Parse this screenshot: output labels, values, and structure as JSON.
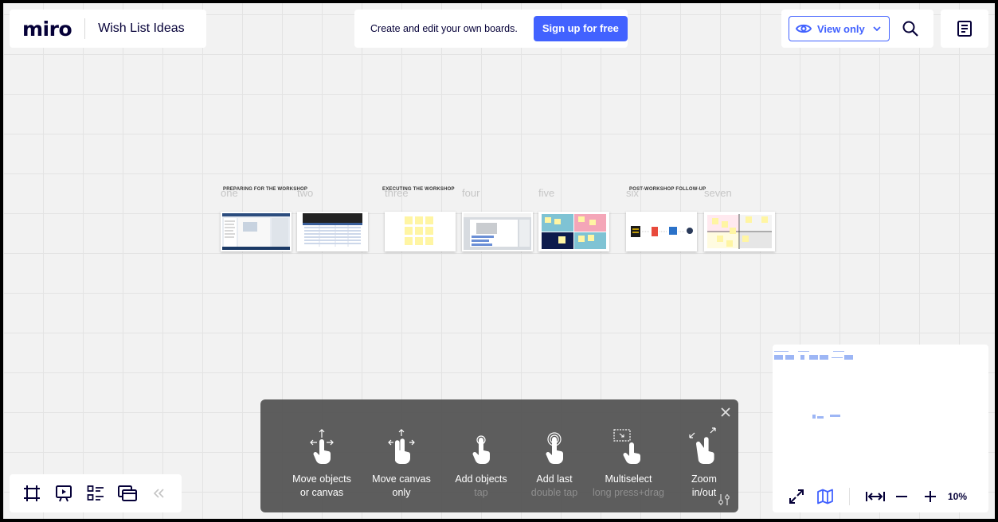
{
  "header": {
    "logo": "miro",
    "board_title": "Wish List Ideas",
    "signup_text": "Create and edit your own boards.",
    "signup_button": "Sign up for free",
    "view_only": "View only"
  },
  "board": {
    "sections": [
      {
        "title": "PREPARING FOR THE WORKSHOP"
      },
      {
        "title": "EXECUTING THE WORKSHOP"
      },
      {
        "title": "POST-WORKSHOP FOLLOW-UP"
      }
    ],
    "frames": [
      "one",
      "two",
      "three",
      "four",
      "five",
      "six",
      "seven"
    ]
  },
  "gestures": [
    {
      "label": "Move objects",
      "label2": "or canvas",
      "sub": "",
      "icon": "one-finger-move-icon"
    },
    {
      "label": "Move canvas",
      "label2": "only",
      "sub": "",
      "icon": "two-finger-move-icon"
    },
    {
      "label": "Add objects",
      "label2": "",
      "sub": "tap",
      "icon": "tap-icon"
    },
    {
      "label": "Add last",
      "label2": "",
      "sub": "double tap",
      "icon": "double-tap-icon"
    },
    {
      "label": "Multiselect",
      "label2": "",
      "sub": "long press+drag",
      "icon": "multiselect-icon"
    },
    {
      "label": "Zoom",
      "label2": "in/out",
      "sub": "",
      "icon": "pinch-zoom-icon"
    }
  ],
  "minimap": {
    "zoom": "10%"
  },
  "colors": {
    "accent": "#4262ff",
    "sticky": "#fff5a3",
    "text": "#050038"
  }
}
